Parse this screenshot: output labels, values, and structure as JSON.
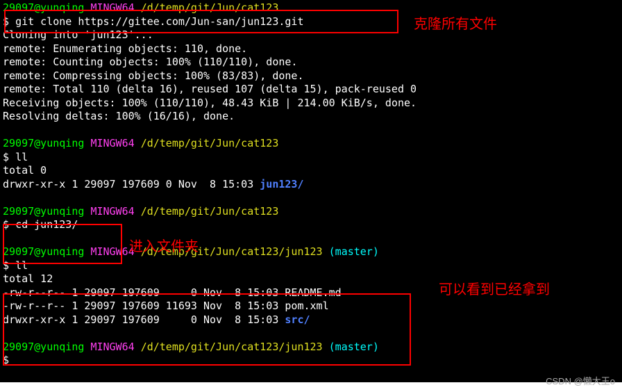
{
  "block1": {
    "user": "29097@yunqing",
    "shell": "MINGW64",
    "path": "/d/temp/git/Jun/cat123",
    "cmd": "git clone https://gitee.com/Jun-san/jun123.git",
    "out": [
      "Cloning into 'jun123'...",
      "remote: Enumerating objects: 110, done.",
      "remote: Counting objects: 100% (110/110), done.",
      "remote: Compressing objects: 100% (83/83), done.",
      "remote: Total 110 (delta 16), reused 107 (delta 15), pack-reused 0",
      "Receiving objects: 100% (110/110), 48.43 KiB | 214.00 KiB/s, done.",
      "Resolving deltas: 100% (16/16), done."
    ]
  },
  "block2": {
    "user": "29097@yunqing",
    "shell": "MINGW64",
    "path": "/d/temp/git/Jun/cat123",
    "cmd": "ll",
    "out_total": "total 0",
    "ls_line": "drwxr-xr-x 1 29097 197609 0 Nov  8 15:03 ",
    "ls_dir": "jun123/"
  },
  "block3": {
    "user": "29097@yunqing",
    "shell": "MINGW64",
    "path": "/d/temp/git/Jun/cat123",
    "cmd": "cd jun123/"
  },
  "block4": {
    "user": "29097@yunqing",
    "shell": "MINGW64",
    "path": "/d/temp/git/Jun/cat123/jun123",
    "branch": "(master)",
    "cmd": "ll",
    "out_total": "total 12",
    "rows": [
      {
        "perm": "-rw-r--r-- 1 29097 197609     0 Nov  8 15:03 ",
        "name": "README.md",
        "cls": "white"
      },
      {
        "perm": "-rw-r--r-- 1 29097 197609 11693 Nov  8 15:03 ",
        "name": "pom.xml",
        "cls": "white"
      },
      {
        "perm": "drwxr-xr-x 1 29097 197609     0 Nov  8 15:03 ",
        "name": "src/",
        "cls": "blue"
      }
    ]
  },
  "block5": {
    "user": "29097@yunqing",
    "shell": "MINGW64",
    "path": "/d/temp/git/Jun/cat123/jun123",
    "branch": "(master)",
    "cmd": ""
  },
  "annot1": "克隆所有文件",
  "annot2": "进入文件夹",
  "annot3": "可以看到已经拿到",
  "watermark": "CSDN @懒大王o"
}
